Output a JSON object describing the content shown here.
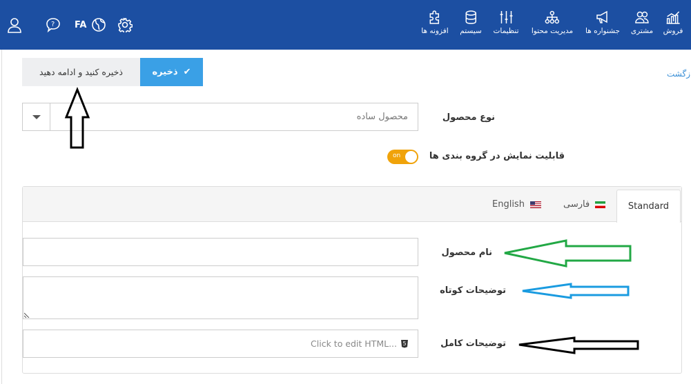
{
  "header": {
    "nav": [
      {
        "label": "فروش",
        "icon": "chart-icon"
      },
      {
        "label": "مشتری",
        "icon": "users-icon"
      },
      {
        "label": "جشنواره ها",
        "icon": "megaphone-icon"
      },
      {
        "label": "مدیریت محتوا",
        "icon": "sitemap-icon"
      },
      {
        "label": "تنظیمات",
        "icon": "sliders-icon"
      },
      {
        "label": "سیستم",
        "icon": "database-icon"
      },
      {
        "label": "افزونه ها",
        "icon": "puzzle-icon"
      }
    ],
    "language": "FA"
  },
  "toolbar": {
    "save_continue": "ذخیره کنید و ادامه دهید",
    "save": "ذخیره",
    "back": "(بازگشت"
  },
  "form": {
    "product_type_label": "نوع محصول",
    "product_type_value": "محصول ساده",
    "visible_label": "قابلیت نمایش در گروه بندی ها",
    "visible_toggle": "on",
    "tabs": [
      "Standard",
      "فارسی",
      "English"
    ],
    "active_tab": "Standard",
    "name_label": "نام محصول",
    "short_desc_label": "توضیحات کوتاه",
    "full_desc_label": "توضیحات کامل",
    "html_placeholder": "Click to edit HTML..."
  },
  "colors": {
    "header": "#1c4fa2",
    "primary": "#3aa0e6",
    "toggle": "#f0a30a",
    "arrow_green": "#22a845",
    "arrow_blue": "#1a9be0"
  }
}
